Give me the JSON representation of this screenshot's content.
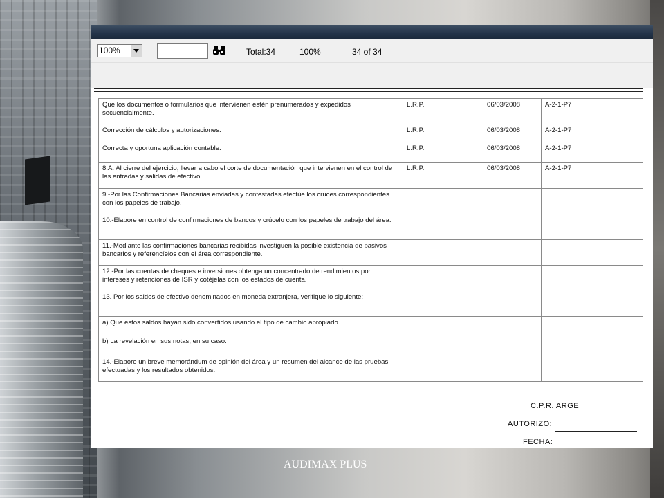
{
  "toolbar": {
    "zoom_value": "100%",
    "search_value": "",
    "total_label": "Total:34",
    "zoom_percent": "100%",
    "page_indicator": "34 of 34"
  },
  "table": {
    "rows": [
      {
        "procedure": "Que los documentos o formularios que intervienen estén prenumerados y expedidos secuencialmente.",
        "initials": "L.R.P.",
        "date": "06/03/2008",
        "reference": "A-2-1-P7"
      },
      {
        "procedure": "Corrección de cálculos y autorizaciones.",
        "initials": "L.R.P.",
        "date": "06/03/2008",
        "reference": "A-2-1-P7"
      },
      {
        "procedure": "Correcta y oportuna aplicación contable.",
        "initials": "L.R.P.",
        "date": "06/03/2008",
        "reference": "A-2-1-P7"
      },
      {
        "procedure": "8.A. Al cierre del ejercicio, llevar a cabo el corte de documentación que intervienen en el control de las entradas y salidas de efectivo",
        "initials": "L.R.P.",
        "date": "06/03/2008",
        "reference": "A-2-1-P7"
      },
      {
        "procedure": "9.-Por las Confirmaciones Bancarias enviadas y contestadas efectúe los cruces correspondientes con los papeles de trabajo.",
        "initials": "",
        "date": "",
        "reference": ""
      },
      {
        "procedure": "10.-Elabore en control de confirmaciones de bancos y crúcelo con los papeles de trabajo del área.",
        "initials": "",
        "date": "",
        "reference": ""
      },
      {
        "procedure": "11.-Mediante las confirmaciones bancarias recibidas investiguen la posible existencia de pasivos bancarios y referencíelos con el área correspondiente.",
        "initials": "",
        "date": "",
        "reference": ""
      },
      {
        "procedure": "12.-Por las cuentas de cheques e inversiones obtenga un concentrado de rendimientos por intereses y retenciones de ISR y cotéjelas con los estados de cuenta.",
        "initials": "",
        "date": "",
        "reference": ""
      },
      {
        "procedure": "13. Por los saldos de efectivo denominados en moneda extranjera, verifique lo siguiente:",
        "initials": "",
        "date": "",
        "reference": ""
      },
      {
        "procedure": "a) Que estos saldos hayan sido convertidos usando el tipo de cambio apropiado.",
        "initials": "",
        "date": "",
        "reference": ""
      },
      {
        "procedure": "b) La revelación en sus notas, en su caso.",
        "initials": "",
        "date": "",
        "reference": ""
      },
      {
        "procedure": "14.-Elabore un breve memorándum de opinión del área y un resumen del alcance de las pruebas efectuadas y los resultados obtenidos.",
        "initials": "",
        "date": "",
        "reference": ""
      }
    ]
  },
  "signature": {
    "cpr": "C.P.R.   ARGE",
    "autorizo": "AUTORIZO:",
    "fecha": "FECHA:"
  },
  "footer": {
    "brand": "AUDIMAX PLUS"
  }
}
